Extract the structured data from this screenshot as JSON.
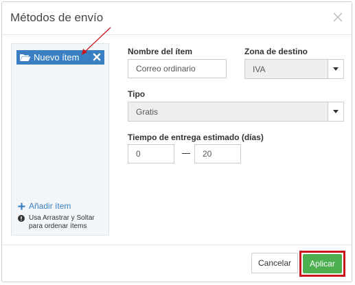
{
  "dialog": {
    "title": "Métodos de envío"
  },
  "sidebar": {
    "items": [
      {
        "label": "Nuevo ítem",
        "selected": true
      }
    ],
    "add_item_label": "Añadir ítem",
    "hint_text": "Usa Arrastrar y Soltar para ordenar ítems"
  },
  "form": {
    "item_name": {
      "label": "Nombre del ítem",
      "value": "Correo ordinario"
    },
    "destination_zone": {
      "label": "Zona de destino",
      "value": "IVA"
    },
    "type": {
      "label": "Tipo",
      "value": "Gratis"
    },
    "delivery_time": {
      "label": "Tiempo de entrega estimado (días)",
      "min": "0",
      "max": "20"
    }
  },
  "footer": {
    "cancel_label": "Cancelar",
    "apply_label": "Aplicar"
  },
  "colors": {
    "selected_item_bg": "#3a7fc1",
    "apply_button": "#4caf50",
    "annotation_red": "#c8161d"
  }
}
